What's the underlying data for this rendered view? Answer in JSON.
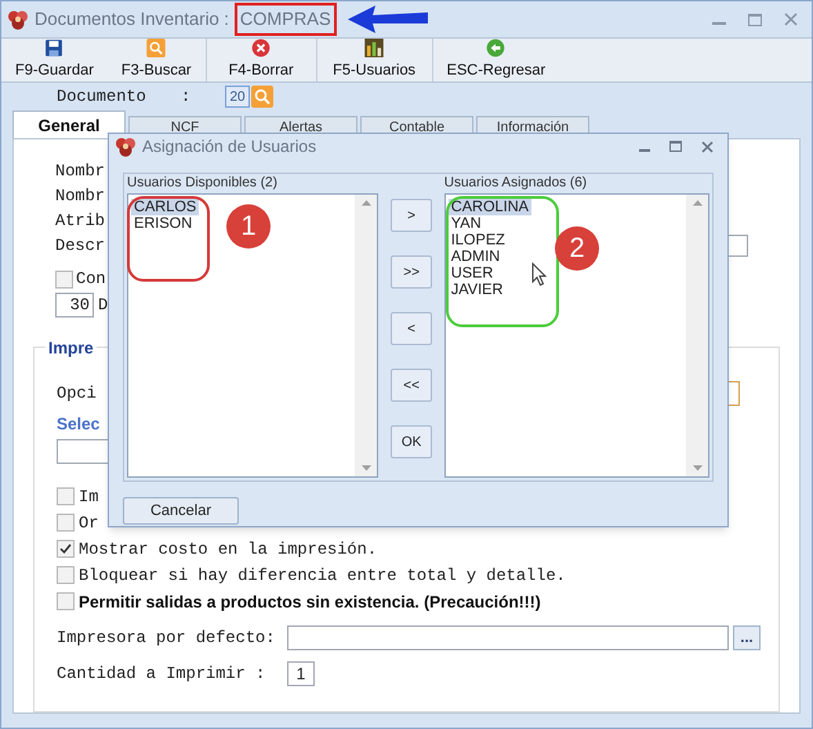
{
  "window": {
    "title": "Documentos Inventario :",
    "title_highlight": "COMPRAS"
  },
  "toolbar": [
    {
      "label": "F9-Guardar",
      "kind": "save"
    },
    {
      "label": "F3-Buscar",
      "kind": "search"
    },
    {
      "label": "F4-Borrar",
      "kind": "delete"
    },
    {
      "label": "F5-Usuarios",
      "kind": "users"
    },
    {
      "label": "ESC-Regresar",
      "kind": "back"
    }
  ],
  "document": {
    "label": "Documento",
    "colon": ":",
    "value": "20"
  },
  "tabs": [
    {
      "label": "General",
      "selected": true
    },
    {
      "label": "NCF",
      "selected": false
    },
    {
      "label": "Alertas",
      "selected": false
    },
    {
      "label": "Contable",
      "selected": false
    },
    {
      "label": "Información",
      "selected": false
    }
  ],
  "general": {
    "labels": [
      "Nombr",
      "Nombr",
      "Atrib",
      "Descr"
    ],
    "check": {
      "label": "Con",
      "checked": false
    },
    "days": {
      "value": "30",
      "label": "D"
    }
  },
  "printing": {
    "title": "Impre",
    "option_label": "Opci",
    "select_label": "Selec",
    "checks": [
      {
        "label": "Im",
        "checked": false,
        "bold": false
      },
      {
        "label": "Or",
        "checked": false,
        "bold": false
      },
      {
        "label": "Mostrar costo en la impresión.",
        "checked": true,
        "bold": false
      },
      {
        "label": "Bloquear si hay diferencia entre total y detalle.",
        "checked": false,
        "bold": false
      },
      {
        "label": "Permitir salidas a productos sin existencia. (Precaución!!!)",
        "checked": false,
        "bold": true
      }
    ],
    "printer_label": "Impresora por defecto:",
    "browse": "...",
    "quantity_label": "Cantidad a Imprimir :",
    "quantity": "1"
  },
  "dialog": {
    "title": "Asignación de Usuarios",
    "available": {
      "label": "Usuarios Disponibles (2)",
      "items": [
        {
          "text": "CARLOS",
          "selected": true
        },
        {
          "text": "ERISON",
          "selected": false
        }
      ]
    },
    "assigned": {
      "label": "Usuarios Asignados (6)",
      "items": [
        {
          "text": "CAROLINA",
          "selected": true
        },
        {
          "text": "YAN",
          "selected": false
        },
        {
          "text": "ILOPEZ",
          "selected": false
        },
        {
          "text": "ADMIN",
          "selected": false
        },
        {
          "text": "USER",
          "selected": false
        },
        {
          "text": "JAVIER",
          "selected": false
        }
      ]
    },
    "buttons": [
      ">",
      ">>",
      "<",
      "<<",
      "OK"
    ],
    "cancel": "Cancelar"
  },
  "annotations": [
    "1",
    "2"
  ]
}
